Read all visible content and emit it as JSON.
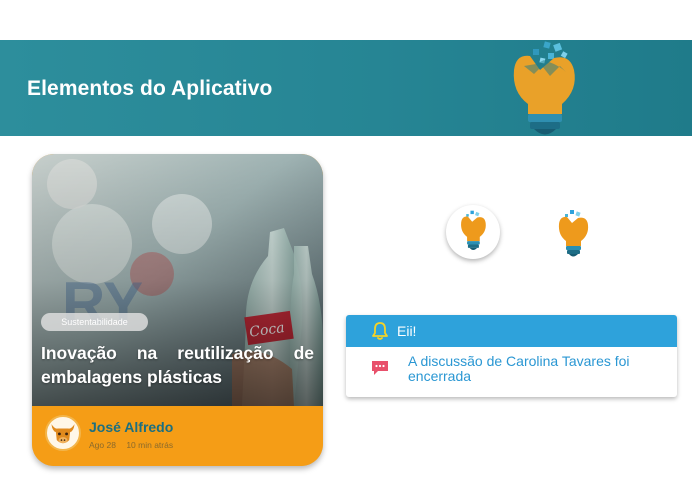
{
  "header": {
    "title": "Elementos do Aplicativo"
  },
  "card": {
    "tag": "Sustentabilidade",
    "title": "Inovação na reutilização de embalagens plásticas",
    "author": "José Alfredo",
    "date": "Ago 28",
    "time_ago": "10 min atrás"
  },
  "notification": {
    "title": "Eii!",
    "message": "A discussão de Carolina Tavares foi encerrada"
  },
  "colors": {
    "header_bg": "#268594",
    "card_footer": "#f59d16",
    "author_text": "#1b6f80",
    "notification_header": "#2ea2db",
    "notification_text": "#2a97d3"
  },
  "icons": {
    "header": "lightbulb-icon",
    "circle": "lightbulb-icon",
    "plain": "lightbulb-icon",
    "notification_title": "bell-icon",
    "notification_message": "chat-icon",
    "avatar": "bull-icon"
  }
}
